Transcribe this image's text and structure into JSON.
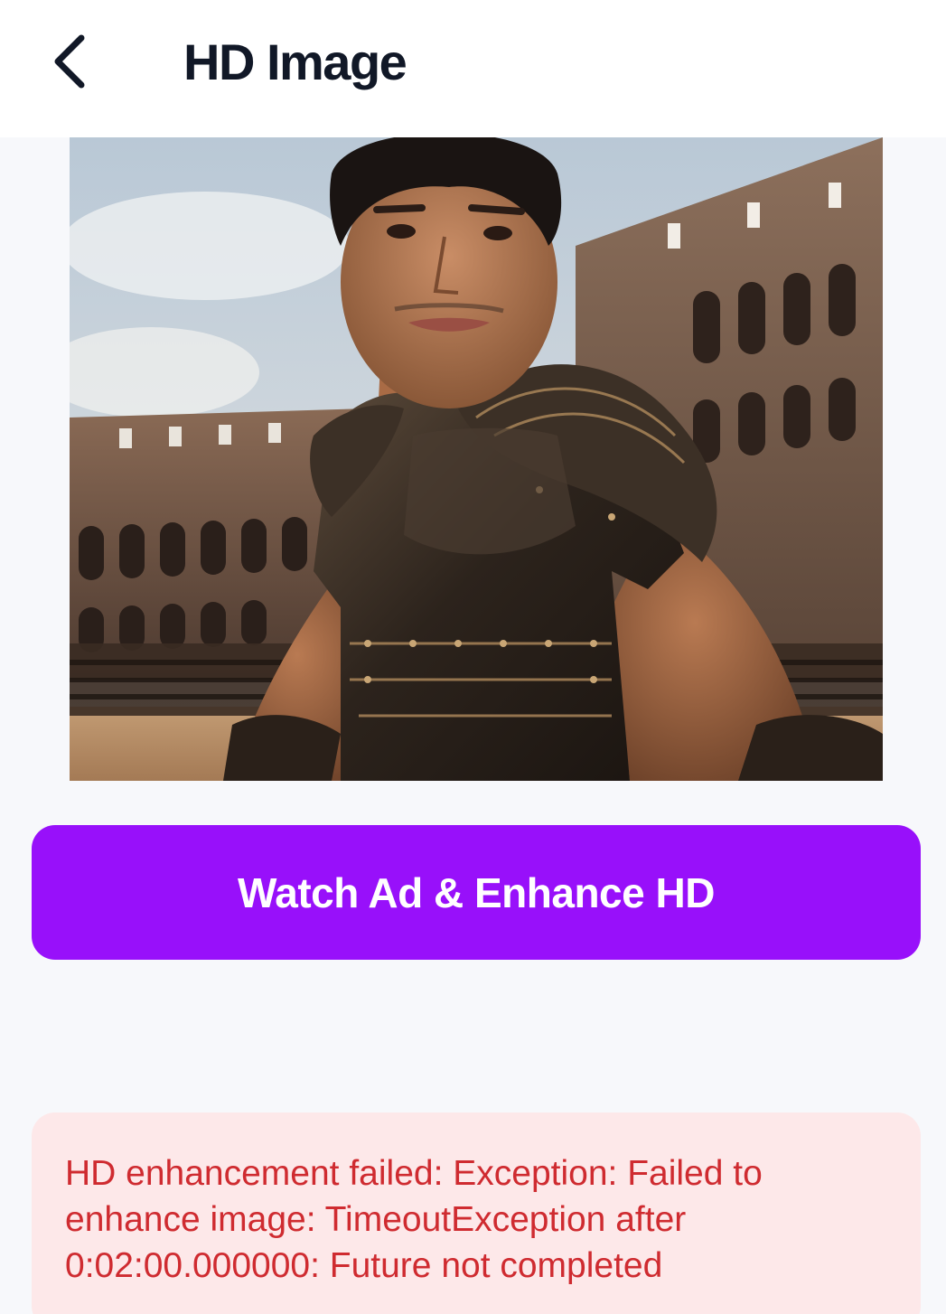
{
  "header": {
    "title": "HD Image",
    "back_icon": "chevron-left-icon"
  },
  "preview": {
    "subject": "warrior-portrait-image"
  },
  "actions": {
    "enhance_label": "Watch Ad & Enhance HD"
  },
  "error": {
    "message": "HD enhancement failed: Exception: Failed to enhance image: TimeoutException after 0:02:00.000000: Future not completed"
  },
  "colors": {
    "accent": "#9810fa",
    "error_text": "#cf2b30",
    "error_background": "#fde8e9",
    "background": "#f7f8fb",
    "title": "#111827"
  }
}
